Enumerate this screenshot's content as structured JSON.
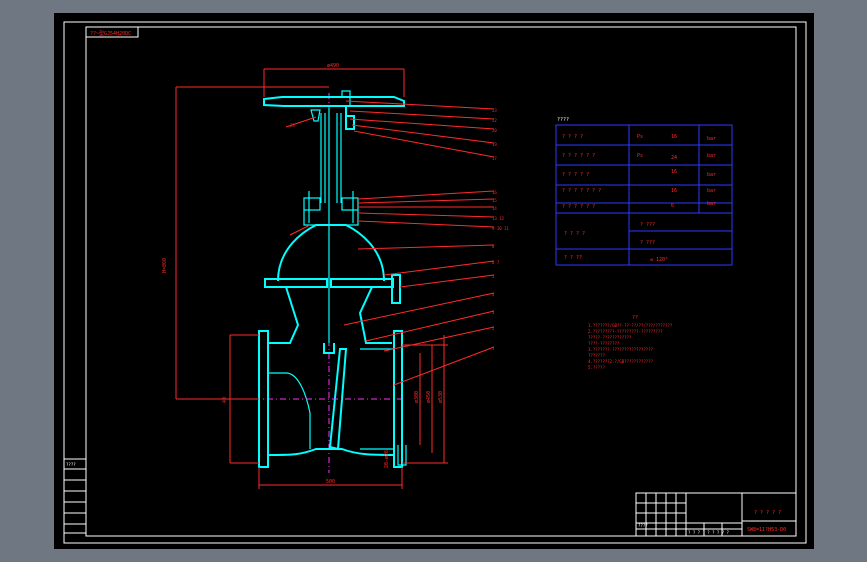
{
  "drawing": {
    "top_left_label": "??~型GJ54H20DC",
    "dim_handwheel": "ø490",
    "dim_height": "H=860",
    "dim_length": "500",
    "dim_d1": "ø300",
    "dim_d2": "ø450",
    "dim_d3": "ø530",
    "dim_bolt": "20-ø26",
    "dim_top": "40",
    "callouts": [
      "23",
      "22",
      "20",
      "19",
      "17",
      "16",
      "15",
      "14",
      "13 12",
      "9 10 11",
      "8",
      "6 7",
      "5",
      "4",
      "3",
      "2",
      "1"
    ],
    "tech_req_title": "??",
    "tech_req_lines": [
      "1.???????/GB??-??-??/??/???/???????",
      "2.?????????-?????????-?????????",
      "  ?????-????????????",
      "  ????-????????",
      "3.???????-?????????????????",
      "  ???????",
      "4.???????2.?/GB????????????",
      "5.?????"
    ]
  },
  "spec_table": {
    "title": "????",
    "rows": [
      {
        "name": "? ? ? ?",
        "sym": "Ps",
        "val": "16",
        "unit": "bar"
      },
      {
        "name": "? ? ? ? ? ?",
        "sym": "Ps",
        "val": "24",
        "unit": "bar"
      },
      {
        "name": "? ? ? ? ?",
        "sym": "",
        "val": "16",
        "unit": "bar"
      },
      {
        "name": "? ? ? ? ? ? ?",
        "sym": "",
        "val": "16",
        "unit": "bar"
      },
      {
        "name": "? ? ? ? ? ?",
        "sym": "",
        "val": "6",
        "unit": "bar"
      }
    ],
    "media_label": "? ? ? ?",
    "media_1": "? ???",
    "media_2": "? ???",
    "temp_label": "? ? ??",
    "temp_val": "≤ 120°"
  },
  "title_block": {
    "name": "? ? ? ? ?",
    "code": "SW8=11?H53-D0",
    "small_rows": [
      "? ?",
      "? ?",
      "? ?",
      "? ?",
      "? ?",
      "? ?"
    ],
    "stamp": "????",
    "sign_row": "? ? ? ? ? ? ? ? ?"
  },
  "colors": {
    "background": "#000000",
    "body_lines": "#00ffff",
    "dimension_lines": "#ff2a2a",
    "frame": "#ffffff",
    "table": "#2a3cff",
    "outer": "#6f7782"
  }
}
